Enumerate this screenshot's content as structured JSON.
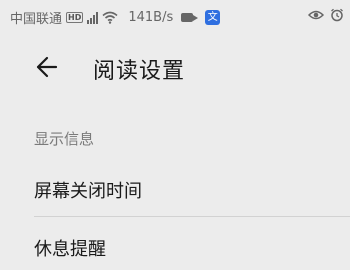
{
  "status_bar": {
    "carrier": "中国联通",
    "network_badge": "HD",
    "network_type": "4G",
    "speed": "141B/s",
    "app_badge": "文",
    "icons": [
      "signal-icon",
      "wifi-icon",
      "video-icon",
      "eye-icon",
      "alarm-icon",
      "battery-icon"
    ]
  },
  "header": {
    "back_icon": "arrow-left-icon",
    "title": "阅读设置"
  },
  "sections": [
    {
      "header": "显示信息",
      "items": [
        {
          "label": "屏幕关闭时间"
        },
        {
          "label": "休息提醒"
        }
      ]
    }
  ],
  "colors": {
    "background": "#ececec",
    "text_primary": "#1a1a1a",
    "text_secondary": "#7a7a7a",
    "divider": "#d2d2d2",
    "app_badge": "#2f6fe0"
  }
}
